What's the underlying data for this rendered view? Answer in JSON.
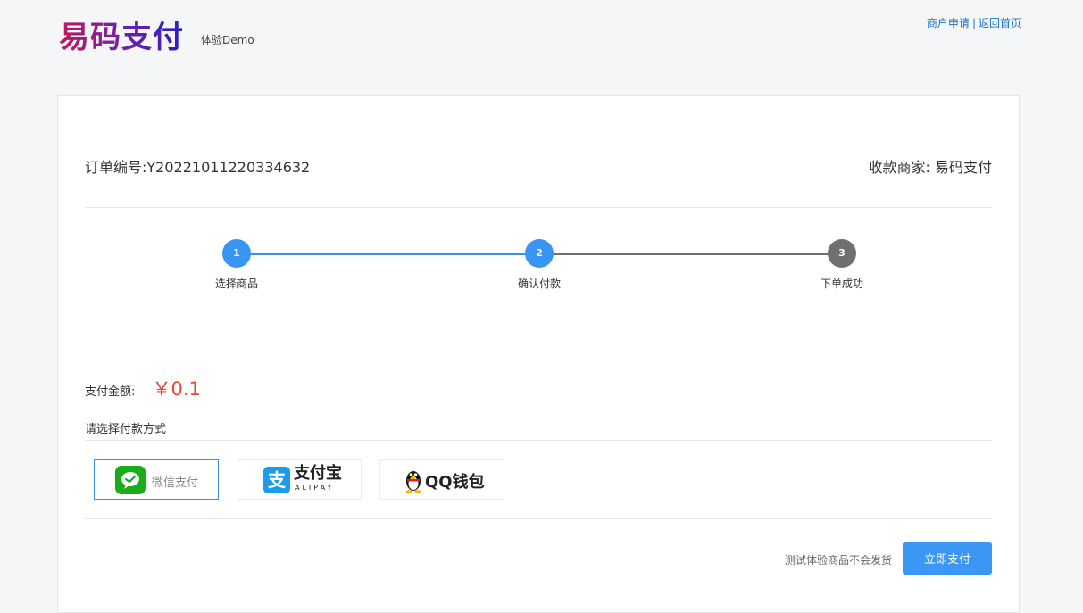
{
  "header": {
    "logo": "易码支付",
    "logo_sub": "体验Demo",
    "links": [
      "商户申请",
      "返回首页"
    ],
    "separator": "|"
  },
  "order": {
    "number_label": "订单编号:",
    "number": "Y20221011220334632",
    "merchant_label": "收款商家:",
    "merchant": "易码支付"
  },
  "steps": [
    {
      "num": "1",
      "label": "选择商品",
      "state": "done"
    },
    {
      "num": "2",
      "label": "确认付款",
      "state": "active"
    },
    {
      "num": "3",
      "label": "下单成功",
      "state": "pending"
    }
  ],
  "payment": {
    "amount_label": "支付金额:",
    "amount": "￥0.1",
    "choose_label": "请选择付款方式",
    "methods": [
      {
        "name": "微信支付",
        "icon": "wechat-icon",
        "selected": true
      },
      {
        "name": "支付宝",
        "sub": "ALIPAY",
        "icon": "alipay-icon",
        "selected": false
      },
      {
        "name": "QQ钱包",
        "icon": "qq-penguin-icon",
        "selected": false
      }
    ],
    "notice": "测试体验商品不会发货",
    "pay_button": "立即支付"
  },
  "colors": {
    "accent": "#3a97f3",
    "amount": "#e8452c",
    "wechat": "#1aad19",
    "alipay": "#1b9bea"
  }
}
